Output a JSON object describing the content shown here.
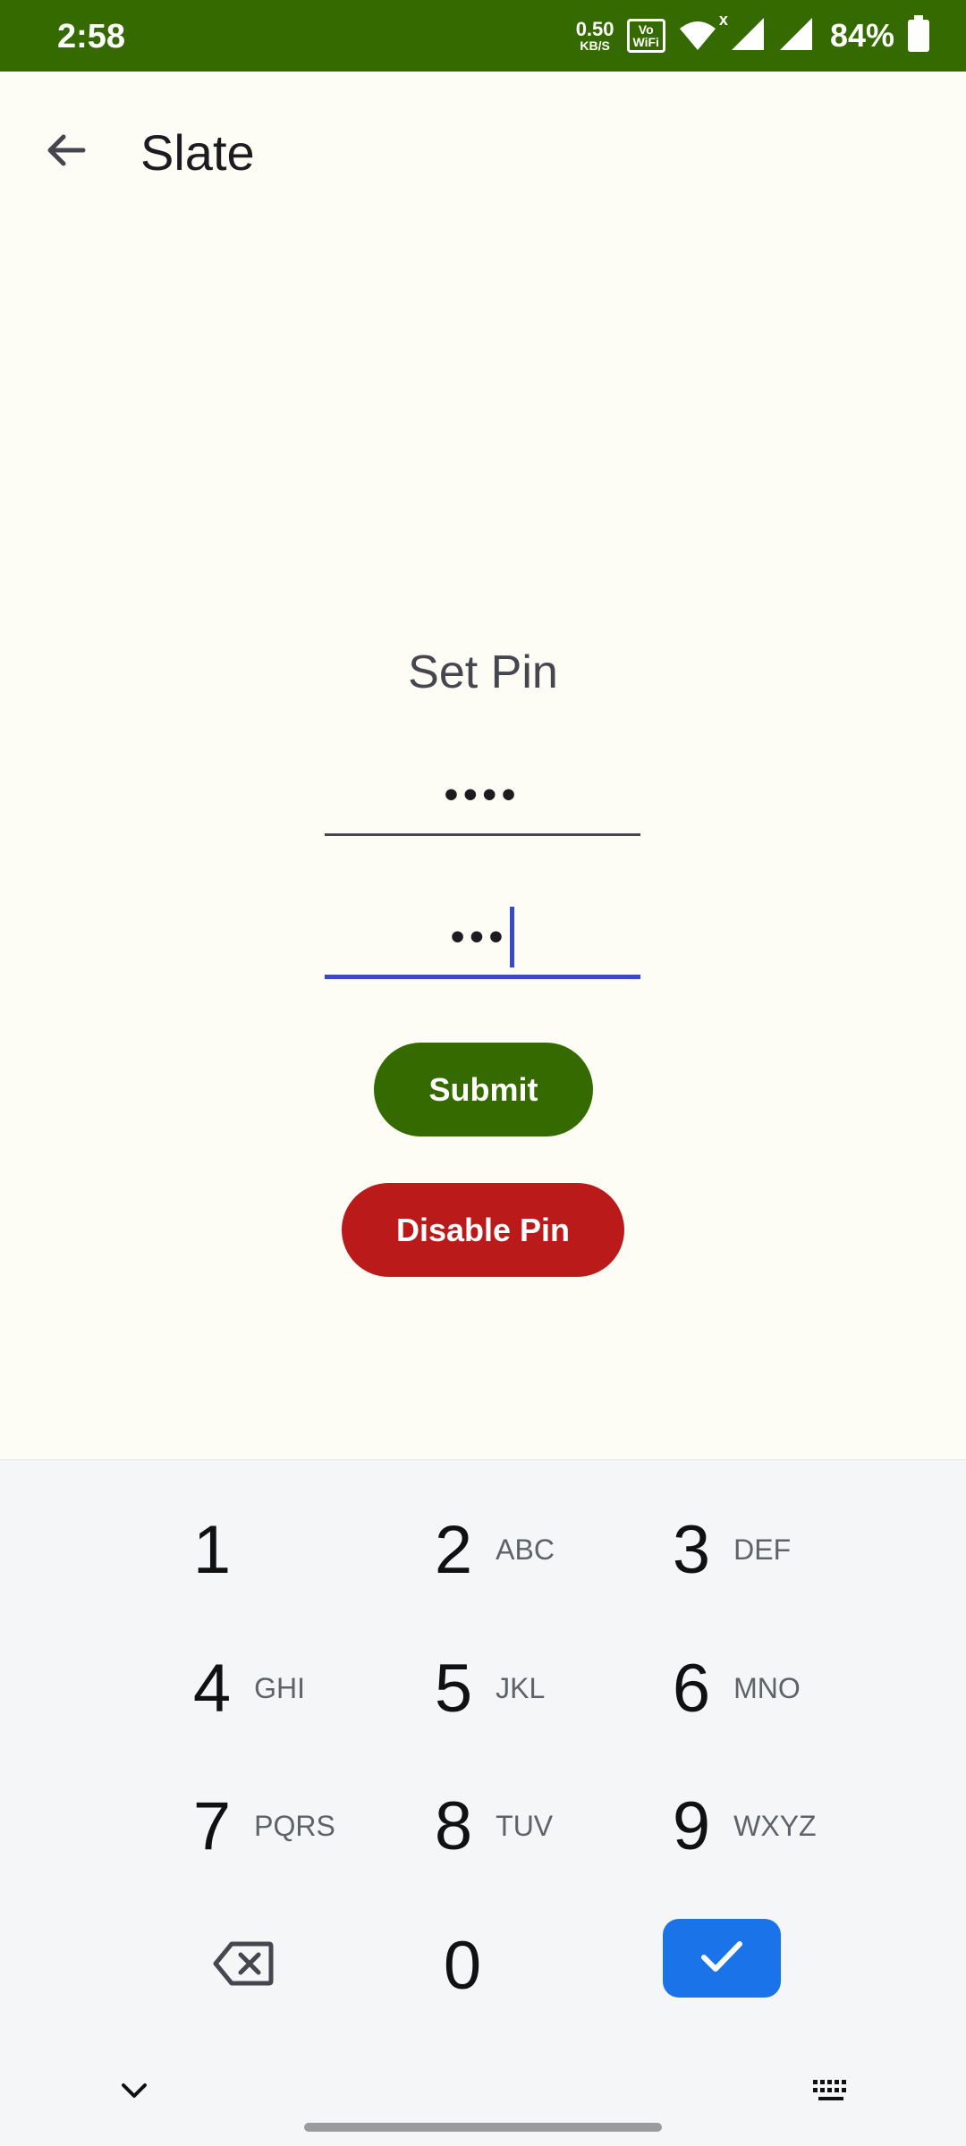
{
  "status_bar": {
    "time": "2:58",
    "net_speed_value": "0.50",
    "net_speed_unit": "KB/S",
    "vowifi_top": "Vo",
    "vowifi_bottom": "WiFi",
    "wifi_badge": "x",
    "battery": "84%"
  },
  "app_bar": {
    "title": "Slate",
    "back_icon": "arrow-back-icon"
  },
  "pin_form": {
    "title": "Set Pin",
    "pin_field_value": "••••",
    "confirm_field_value": "•••",
    "submit_label": "Submit",
    "disable_label": "Disable Pin"
  },
  "colors": {
    "primary": "#356a00",
    "danger": "#ba1a1a",
    "focus": "#3a49c8",
    "keyboard_accent": "#1a73e8",
    "background": "#fdfdf5"
  },
  "keyboard": {
    "keys": [
      {
        "num": "1",
        "letters": ""
      },
      {
        "num": "2",
        "letters": "ABC"
      },
      {
        "num": "3",
        "letters": "DEF"
      },
      {
        "num": "4",
        "letters": "GHI"
      },
      {
        "num": "5",
        "letters": "JKL"
      },
      {
        "num": "6",
        "letters": "MNO"
      },
      {
        "num": "7",
        "letters": "PQRS"
      },
      {
        "num": "8",
        "letters": "TUV"
      },
      {
        "num": "9",
        "letters": "WXYZ"
      },
      {
        "num": "0",
        "letters": ""
      }
    ],
    "backspace_icon": "backspace-icon",
    "enter_icon": "checkmark-icon",
    "hide_icon": "chevron-down-icon",
    "switch_icon": "keyboard-icon"
  }
}
